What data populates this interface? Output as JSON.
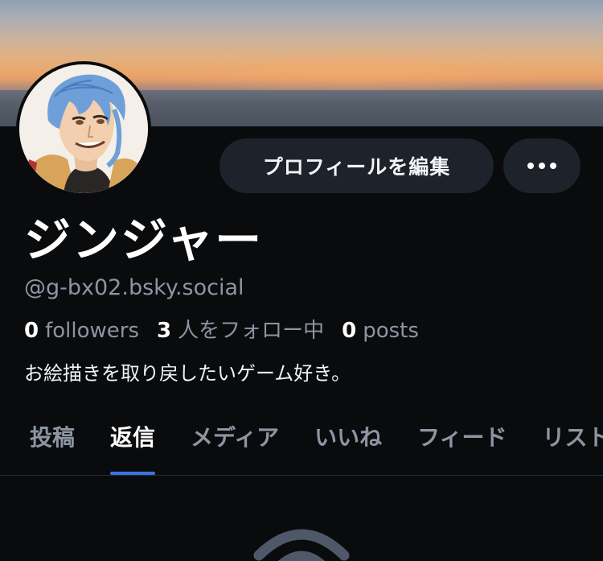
{
  "profile": {
    "display_name": "ジンジャー",
    "handle": "@g-bx02.bsky.social",
    "bio": "お絵描きを取り戻したいゲーム好き。",
    "stats": {
      "followers_count": "0",
      "followers_label": "followers",
      "following_count": "3",
      "following_label": "人をフォロー中",
      "posts_count": "0",
      "posts_label": "posts"
    }
  },
  "actions": {
    "edit_profile_label": "プロフィールを編集",
    "more_icon": "ellipsis-icon"
  },
  "tabs": [
    {
      "label": "投稿",
      "active": false
    },
    {
      "label": "返信",
      "active": true
    },
    {
      "label": "メディア",
      "active": false
    },
    {
      "label": "いいね",
      "active": false
    },
    {
      "label": "フィード",
      "active": false
    },
    {
      "label": "リスト",
      "active": false
    }
  ],
  "colors": {
    "background": "#0a0b0d",
    "button_bg": "#1e222b",
    "muted_text": "#8d95a3",
    "accent": "#3b74e6"
  }
}
